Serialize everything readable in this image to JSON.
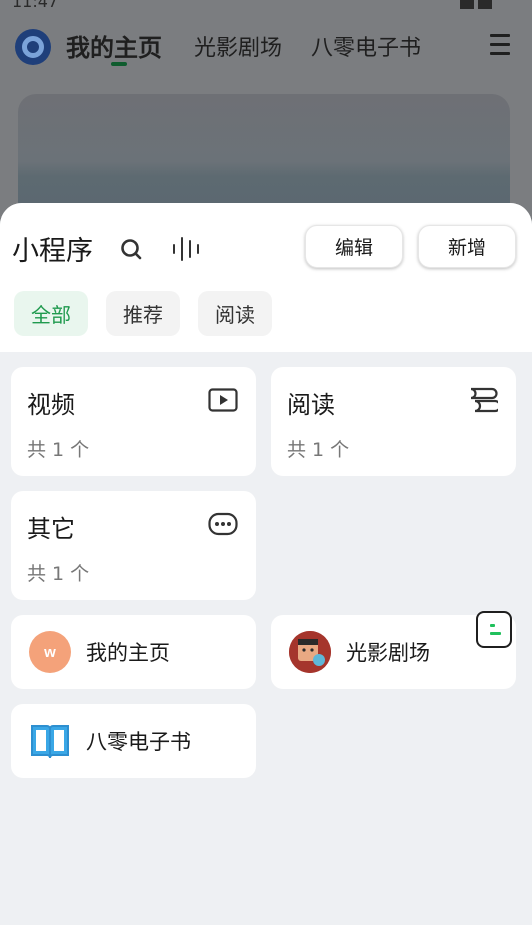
{
  "status_bar": {
    "time": "11:47"
  },
  "top_nav": {
    "tabs": [
      {
        "label": "我的主页",
        "active": true
      },
      {
        "label": "光影剧场",
        "active": false
      },
      {
        "label": "八零电子书",
        "active": false
      }
    ],
    "menu_icon": "hamburger-menu-icon",
    "logo_icon": "ring-logo-icon"
  },
  "sheet": {
    "title": "小程序",
    "search_icon": "search-icon",
    "voice_icon": "voice-wave-icon",
    "edit_label": "编辑",
    "add_label": "新增",
    "filters": [
      {
        "label": "全部",
        "selected": true
      },
      {
        "label": "推荐",
        "selected": false
      },
      {
        "label": "阅读",
        "selected": false
      }
    ],
    "categories": [
      {
        "title": "视频",
        "count": "共 1 个",
        "icon": "play-video-icon"
      },
      {
        "title": "阅读",
        "count": "共 1 个",
        "icon": "book-reading-icon"
      },
      {
        "title": "其它",
        "count": "共 1 个",
        "icon": "more-dots-icon"
      }
    ],
    "apps": [
      {
        "name": "我的主页",
        "icon": "w-avatar-icon",
        "color": "#f4a27a"
      },
      {
        "name": "光影剧场",
        "icon": "theater-avatar-icon",
        "color": "#b0392f"
      },
      {
        "name": "八零电子书",
        "icon": "open-book-icon",
        "color": "#2d9ae0"
      }
    ]
  },
  "colors": {
    "accent_green": "#1f9a4e",
    "chip_selected_bg": "#e9f6ee",
    "sheet_bg": "#eef0f3"
  }
}
